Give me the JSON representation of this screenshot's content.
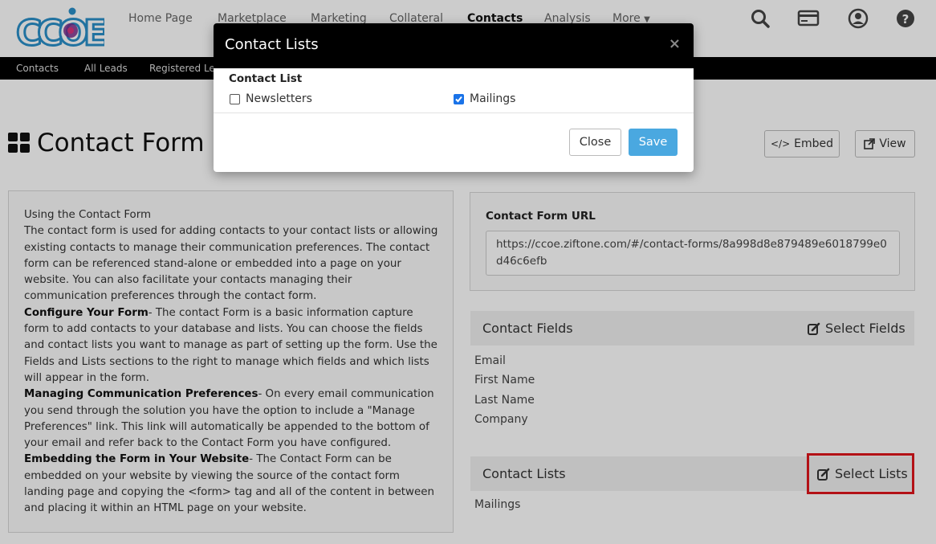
{
  "brand": {
    "logo_text": "CCOE"
  },
  "top_nav": {
    "items": [
      "Home Page",
      "Marketplace",
      "Marketing",
      "Collateral",
      "Contacts",
      "Analysis",
      "More"
    ],
    "active": "Contacts",
    "icons": [
      "search-icon",
      "credit-card-icon",
      "user-account-icon",
      "help-icon"
    ]
  },
  "sub_nav": {
    "items": [
      "Contacts",
      "All Leads",
      "Registered Le"
    ]
  },
  "page": {
    "title": "Contact Form",
    "title_icon": "grid-icon",
    "embed_label": "Embed",
    "view_label": "View"
  },
  "info": {
    "heading": "Using the Contact Form",
    "intro": "The contact form is used for adding contacts to your contact lists or allowing existing contacts to manage their communication preferences. The contact form can be referenced stand-alone or embedded into a page on your website. You can also facilitate your contacts managing their communication preferences through the contact form.",
    "configure_title": "Configure Your Form",
    "configure_text": "- The contact Form is a basic information capture form to add contacts to your database and lists. You can choose the fields and contact lists you want to manage as part of setting up the form. Use the Fields and Lists sections to the right to manage which fields and which lists will appear in the form.",
    "managing_title": "Managing Communication Preferences",
    "managing_text": "- On every email communication you send through the solution you have the option to include a \"Manage Preferences\" link. This link will automatically be appended to the bottom of your email and refer back to the Contact Form you have configured.",
    "embedding_title": "Embedding the Form in Your Website",
    "embedding_text": "- The Contact Form can be embedded on your website by viewing the source of the contact form landing page and copying the <form> tag and all of the content in between and placing it within an HTML page on your website."
  },
  "url_section": {
    "label": "Contact Form URL",
    "value": "https://ccoe.ziftone.com/#/contact-forms/8a998d8e879489e6018799e0d46c6efb"
  },
  "fields_section": {
    "title": "Contact Fields",
    "action": "Select Fields",
    "items": [
      "Email",
      "First Name",
      "Last Name",
      "Company"
    ]
  },
  "lists_section": {
    "title": "Contact Lists",
    "action": "Select Lists",
    "items": [
      "Mailings"
    ]
  },
  "modal": {
    "title": "Contact Lists",
    "close_glyph": "×",
    "label": "Contact List",
    "options": [
      {
        "label": "Newsletters",
        "checked": false
      },
      {
        "label": "Mailings",
        "checked": true
      }
    ],
    "close_label": "Close",
    "save_label": "Save"
  },
  "colors": {
    "accent": "#4aa8e0",
    "highlight": "#e0161c",
    "checkbox": "#1a73e8",
    "header": "#000000"
  }
}
